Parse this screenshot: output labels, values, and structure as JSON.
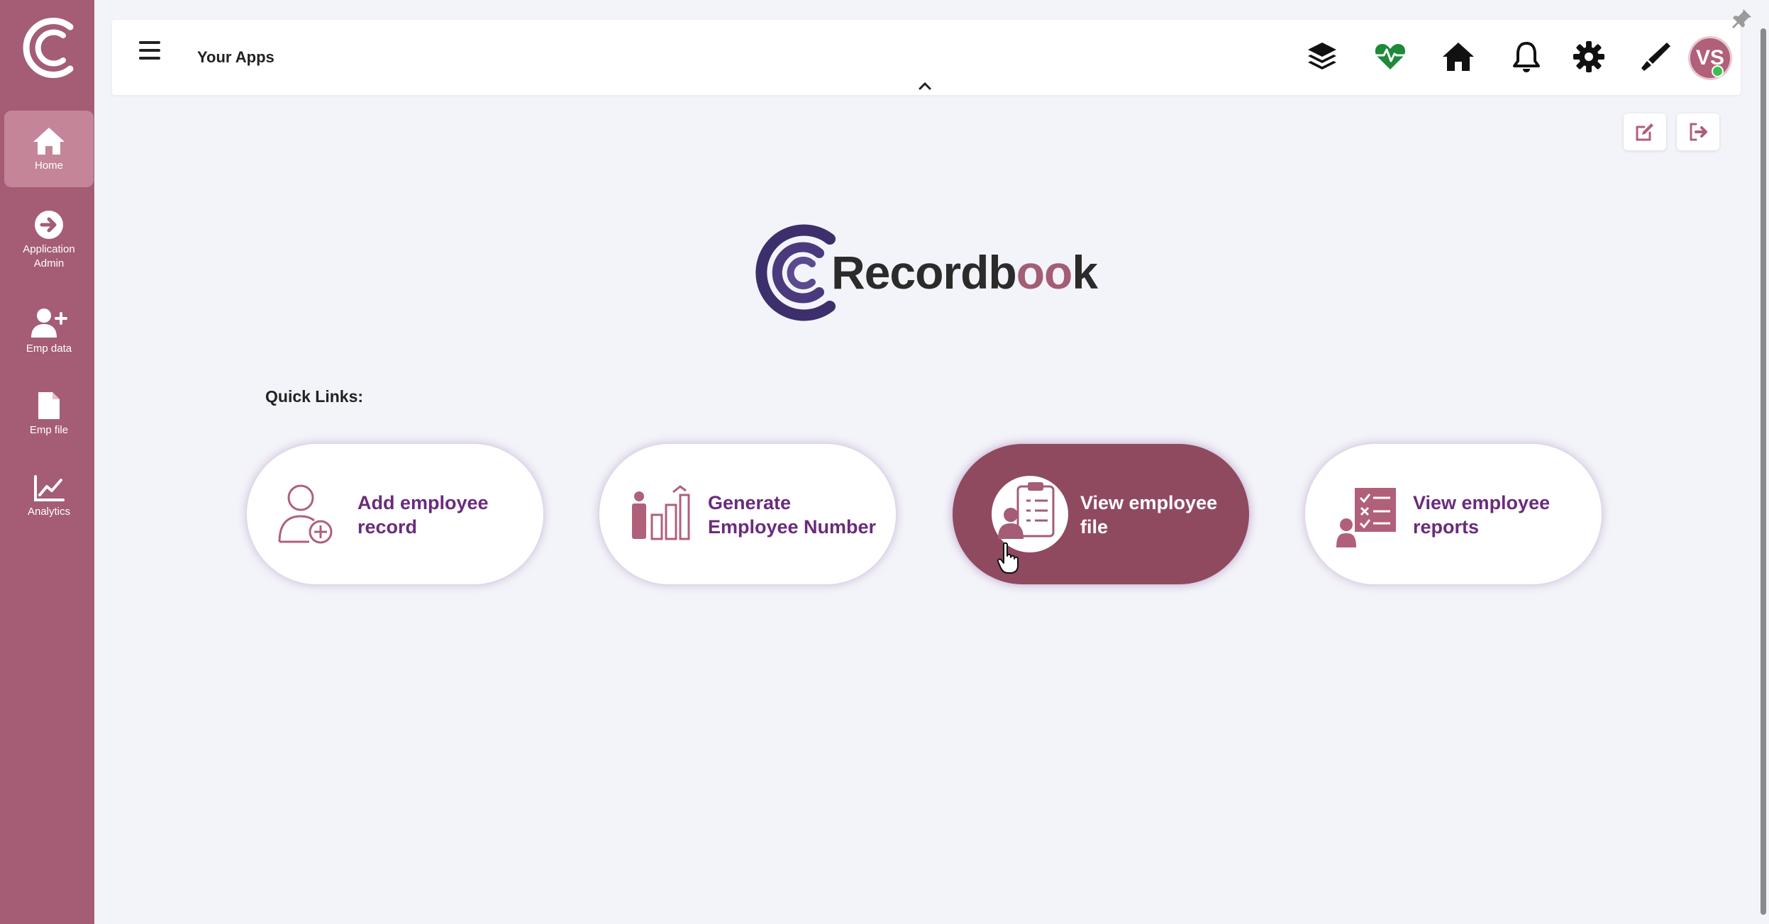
{
  "sidebar": {
    "items": [
      {
        "label": "Home",
        "icon": "home-icon"
      },
      {
        "label": "Application Admin",
        "icon": "arrow-right-circle-icon"
      },
      {
        "label": "Emp data",
        "icon": "user-plus-icon"
      },
      {
        "label": "Emp file",
        "icon": "file-icon"
      },
      {
        "label": "Analytics",
        "icon": "chart-line-icon"
      }
    ]
  },
  "header": {
    "title": "Your Apps",
    "avatar_initials": "VS",
    "icons": [
      "layers-icon",
      "heartbeat-icon",
      "home-icon",
      "bell-icon",
      "gear-icon",
      "pen-icon"
    ]
  },
  "brand": {
    "name_prefix": "Recordb",
    "name_oo": "oo",
    "name_suffix": "k"
  },
  "quick_links": {
    "title": "Quick Links:",
    "items": [
      {
        "label_line1": "Add employee",
        "label_line2": "record"
      },
      {
        "label_line1": "Generate",
        "label_line2": "Employee Number"
      },
      {
        "label_line1": "View employee",
        "label_line2": "file"
      },
      {
        "label_line1": "View employee",
        "label_line2": "reports"
      }
    ]
  },
  "colors": {
    "sidebar": "#a45d74",
    "accent": "#8f4a60",
    "link_text": "#6a2b7d",
    "heartbeat": "#1e8a3a"
  }
}
